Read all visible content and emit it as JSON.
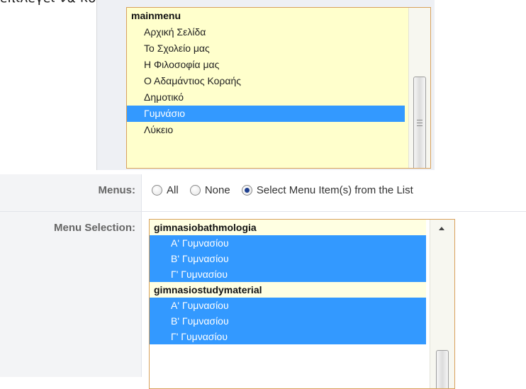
{
  "caption": "επιλέγει να κόψω κάποιο από αυτά.",
  "upper_list": {
    "group": "mainmenu",
    "items": [
      {
        "label": "Αρχική Σελίδα",
        "selected": false
      },
      {
        "label": "Το Σχολείο μας",
        "selected": false
      },
      {
        "label": "Η Φιλοσοφία μας",
        "selected": false
      },
      {
        "label": "Ο Αδαμάντιος Κοραής",
        "selected": false
      },
      {
        "label": "Δημοτικό",
        "selected": false
      },
      {
        "label": "Γυμνάσιο",
        "selected": true
      },
      {
        "label": "Λύκειο",
        "selected": false
      }
    ]
  },
  "menus": {
    "label": "Menus:",
    "options": [
      {
        "label": "All",
        "checked": false
      },
      {
        "label": "None",
        "checked": false
      },
      {
        "label": "Select Menu Item(s) from the List",
        "checked": true
      }
    ]
  },
  "menu_selection": {
    "label": "Menu Selection:",
    "groups": [
      {
        "name": "gimnasiobathmologia",
        "items": [
          "Α' Γυμνασίου",
          "Β' Γυμνασίου",
          "Γ' Γυμνασίου"
        ]
      },
      {
        "name": "gimnasiostudymaterial",
        "items": [
          "Α' Γυμνασίου",
          "Β' Γυμνασίου",
          "Γ' Γυμνασίου"
        ]
      }
    ]
  },
  "colors": {
    "selection": "#3399ff",
    "list_bg": "#ffffcc",
    "border": "#d8a15b"
  }
}
